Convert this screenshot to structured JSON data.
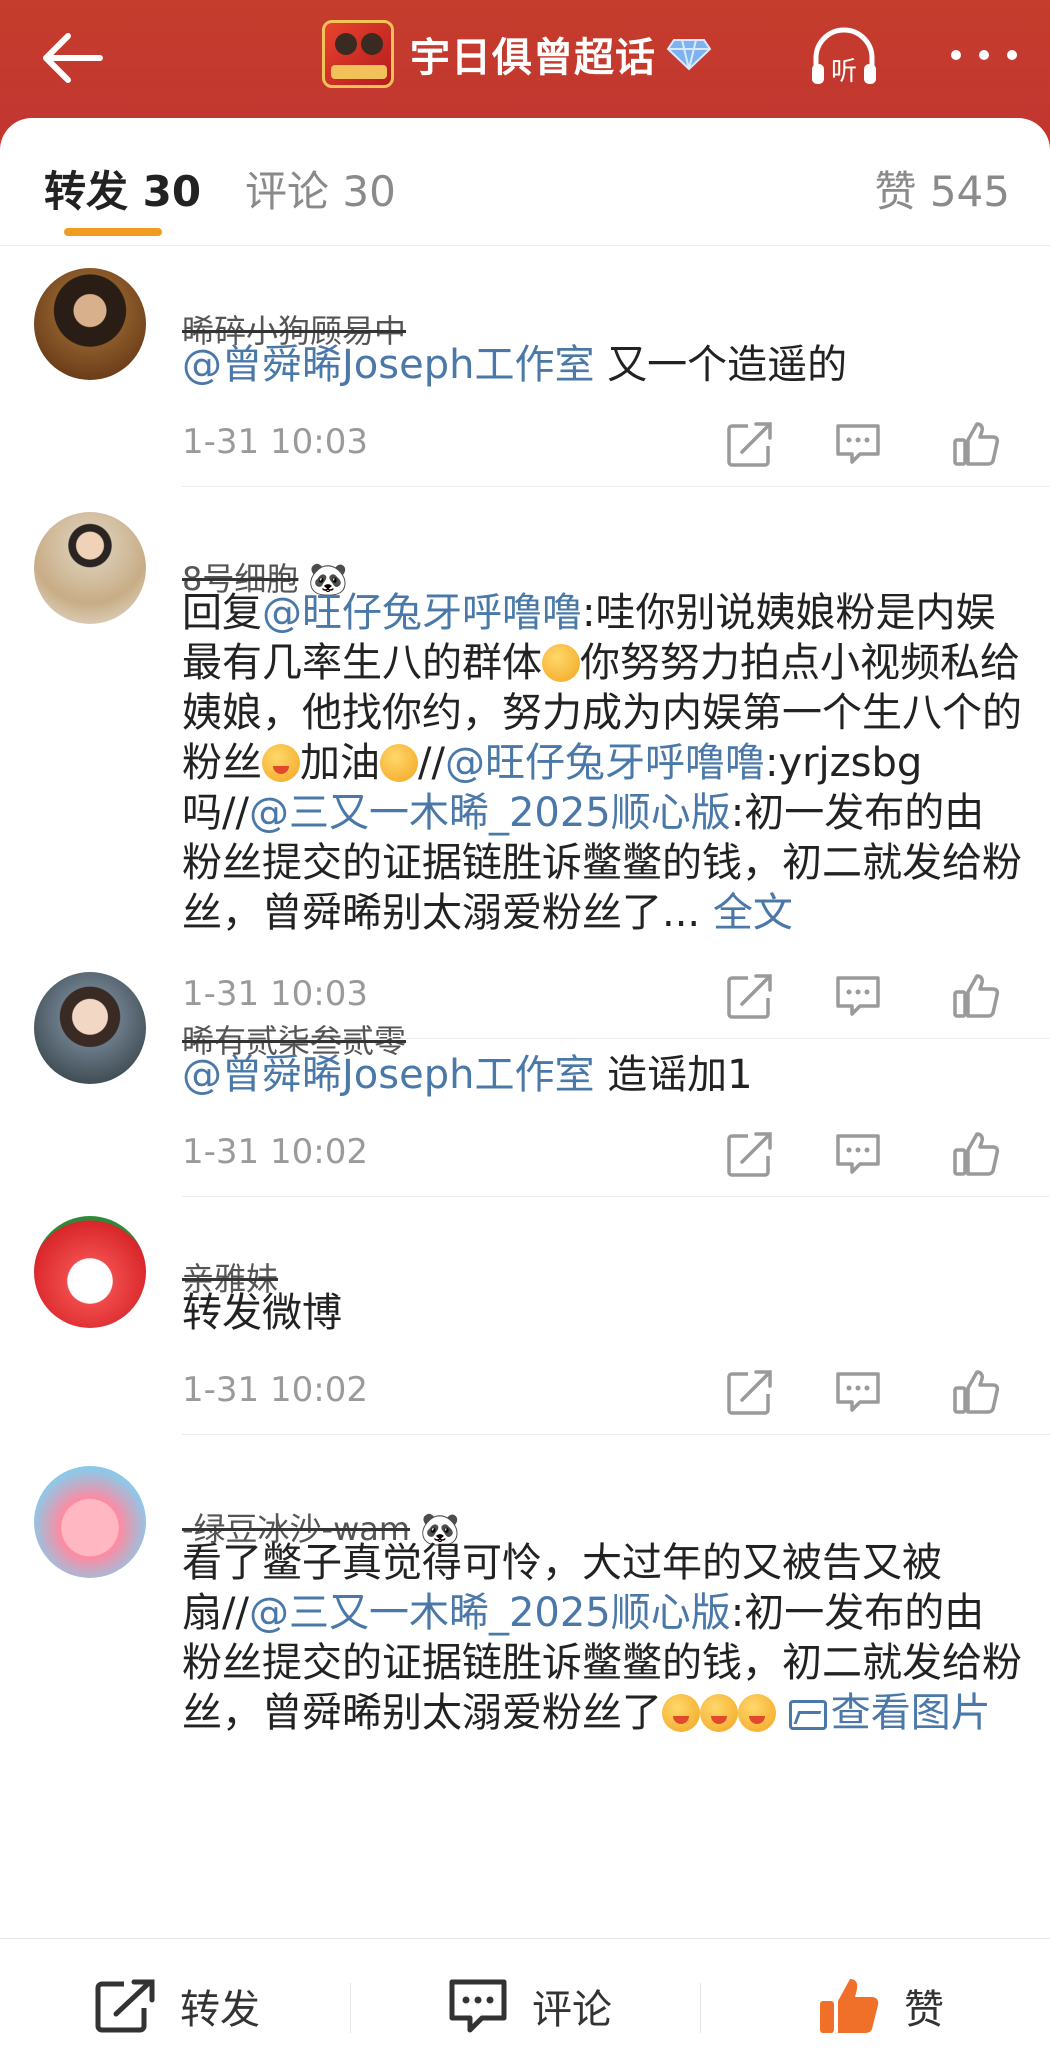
{
  "header": {
    "title": "宇日俱曾超话",
    "icons": {
      "back": "back-arrow-icon",
      "badge": "diamond-badge-icon",
      "listen": "listen-headphone-icon",
      "more": "more-dots-icon"
    },
    "listen_label": "听"
  },
  "tabs": {
    "repost": "转发 30",
    "comment": "评论 30",
    "likes": "赞 545"
  },
  "feed": [
    {
      "username": "晞碎小狗顾易中",
      "segments": [
        {
          "t": "@曾舜晞Joseph工作室",
          "mention": true
        },
        {
          "t": " 又一个造遥的"
        }
      ],
      "time": "1-31 10:03"
    },
    {
      "username": "8号细胞",
      "username_suffix": "🐼",
      "segments": [
        {
          "t": "回复"
        },
        {
          "t": "@旺仔兔牙呼噜噜",
          "mention": true
        },
        {
          "t": ":哇你别说姨娘粉是内娱最有几率生八的群体"
        },
        {
          "emoji": "thinking-emoji"
        },
        {
          "t": "你努努力拍点小视频私给姨娘，他找你约，努力成为内娱第一个生八个的粉丝"
        },
        {
          "emoji": "kiss-emoji"
        },
        {
          "t": "加油"
        },
        {
          "emoji": "tongue-emoji"
        },
        {
          "t": "//"
        },
        {
          "t": "@旺仔兔牙呼噜噜",
          "mention": true
        },
        {
          "t": ":yrjzsbg吗//"
        },
        {
          "t": "@三又一木晞_2025顺心版",
          "mention": true
        },
        {
          "t": ":初一发布的由粉丝提交的证据链胜诉鳖鳖的钱，初二就发给粉丝，曾舜晞别太溺爱粉丝了... "
        },
        {
          "t": "全文",
          "link": true
        }
      ],
      "time": "1-31 10:03"
    },
    {
      "username": "晞有贰柒叁贰零",
      "segments": [
        {
          "t": "@曾舜晞Joseph工作室",
          "mention": true
        },
        {
          "t": " 造谣加1"
        }
      ],
      "time": "1-31 10:02"
    },
    {
      "username": "亲雅妹",
      "segments": [
        {
          "t": "转发微博"
        }
      ],
      "time": "1-31 10:02"
    },
    {
      "username": "-绿豆冰沙-wam",
      "username_suffix": "🐼",
      "segments": [
        {
          "t": "看了鳖子真觉得可怜，大过年的又被告又被扇//"
        },
        {
          "t": "@三又一木晞_2025顺心版",
          "mention": true
        },
        {
          "t": ":初一发布的由粉丝提交的证据链胜诉鳖鳖的钱，初二就发给粉丝，曾舜晞别太溺爱粉丝了"
        },
        {
          "emoji": "kiss-emoji"
        },
        {
          "emoji": "kiss-emoji"
        },
        {
          "emoji": "kiss-emoji"
        },
        {
          "t": " "
        },
        {
          "img": "image-icon"
        },
        {
          "t": "查看图片",
          "link": true
        }
      ],
      "time": ""
    }
  ],
  "item_actions": {
    "repost_icon": "repost-icon",
    "comment_icon": "comment-icon",
    "like_icon": "like-icon"
  },
  "bottom_bar": {
    "repost": "转发",
    "comment": "评论",
    "like": "赞"
  },
  "colors": {
    "header": "#c6342c",
    "accent_tab": "#f29b21",
    "mention": "#4a78a8",
    "like_active": "#f0702a"
  }
}
